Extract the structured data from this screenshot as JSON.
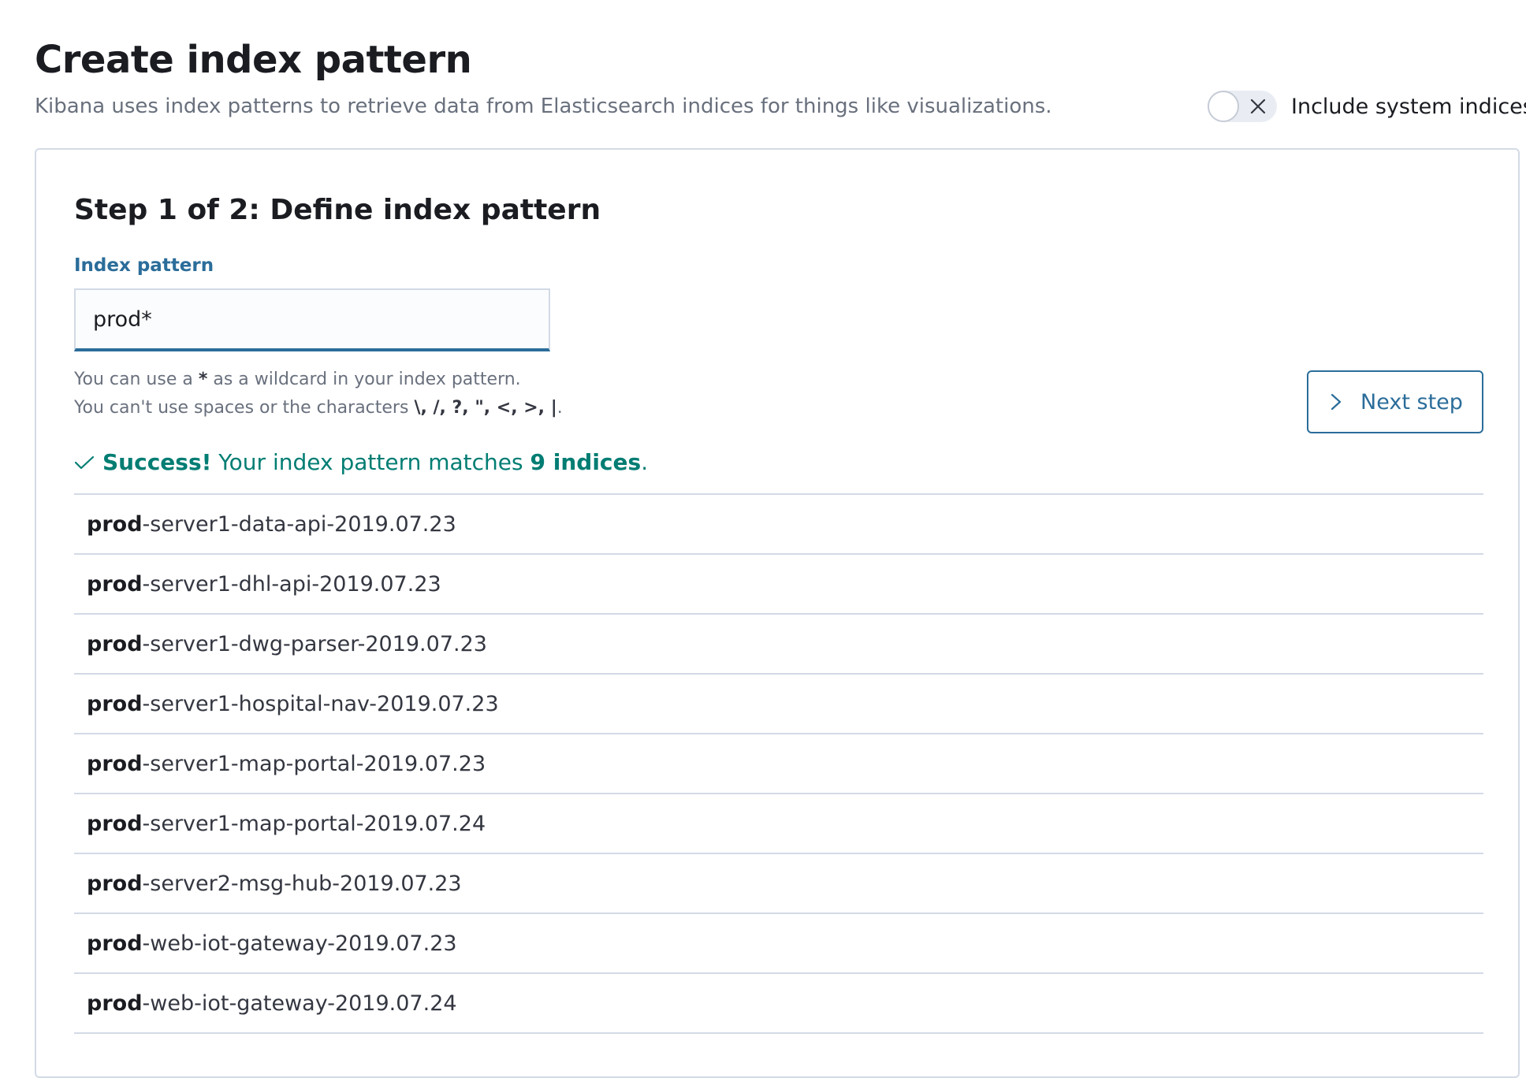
{
  "header": {
    "title": "Create index pattern",
    "subtitle": "Kibana uses index patterns to retrieve data from Elasticsearch indices for things like visualizations.",
    "system_toggle": {
      "label": "Include system indices",
      "on": false
    }
  },
  "step": {
    "title": "Step 1 of 2: Define index pattern",
    "field_label": "Index pattern",
    "input_value": "prod*",
    "help_line1_pre": "You can use a ",
    "help_line1_bold": "*",
    "help_line1_post": " as a wildcard in your index pattern.",
    "help_line2_pre": "You can't use spaces or the characters ",
    "help_line2_bold": "\\, /, ?, \", <, >, |",
    "help_line2_post": ".",
    "next_button": "Next step",
    "next_icon": "chevron-right-icon"
  },
  "success": {
    "icon": "check-icon",
    "strong": "Success!",
    "text_pre": " Your index pattern matches ",
    "count": "9 indices",
    "text_post": "."
  },
  "indices": [
    {
      "match": "prod",
      "rest": "-server1-data-api-2019.07.23"
    },
    {
      "match": "prod",
      "rest": "-server1-dhl-api-2019.07.23"
    },
    {
      "match": "prod",
      "rest": "-server1-dwg-parser-2019.07.23"
    },
    {
      "match": "prod",
      "rest": "-server1-hospital-nav-2019.07.23"
    },
    {
      "match": "prod",
      "rest": "-server1-map-portal-2019.07.23"
    },
    {
      "match": "prod",
      "rest": "-server1-map-portal-2019.07.24"
    },
    {
      "match": "prod",
      "rest": "-server2-msg-hub-2019.07.23"
    },
    {
      "match": "prod",
      "rest": "-web-iot-gateway-2019.07.23"
    },
    {
      "match": "prod",
      "rest": "-web-iot-gateway-2019.07.24"
    }
  ],
  "colors": {
    "accent": "#2b6d9a",
    "success": "#017d73",
    "border": "#d3dae6",
    "subdued_text": "#69707d"
  }
}
